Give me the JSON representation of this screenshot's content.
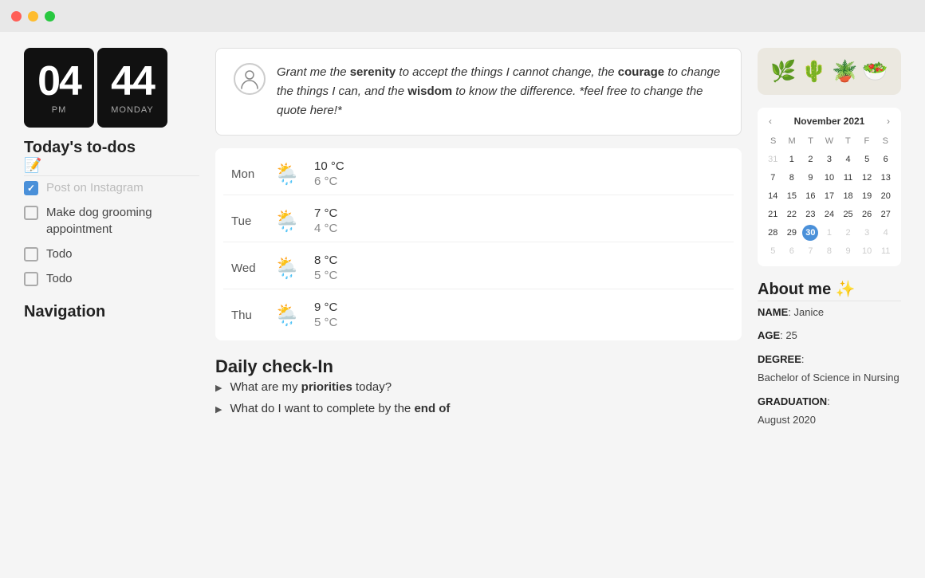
{
  "titlebar": {
    "dots": [
      "red",
      "yellow",
      "green"
    ]
  },
  "clock": {
    "hours": "04",
    "minutes": "44",
    "period": "PM",
    "day": "MONDAY"
  },
  "todos": {
    "section_title": "Today's to-dos",
    "edit_icon": "📝",
    "items": [
      {
        "id": 1,
        "checked": true,
        "text": "Post on Instagram"
      },
      {
        "id": 2,
        "checked": false,
        "text": "Make dog grooming appointment"
      },
      {
        "id": 3,
        "checked": false,
        "text": "Todo"
      },
      {
        "id": 4,
        "checked": false,
        "text": "Todo"
      }
    ]
  },
  "navigation": {
    "title": "Navigation"
  },
  "quote": {
    "text_before_bold1": "Grant me the ",
    "bold1": "serenity",
    "text_after_bold1": " to accept the things I cannot change, the ",
    "bold2": "courage",
    "text_after_bold2": " to change the things I can, and the ",
    "bold3": "wisdom",
    "text_after_bold3": " to know the difference. *feel free to change the quote here!*"
  },
  "weather": {
    "days": [
      {
        "day": "Mon",
        "icon": "🌧️",
        "high": "10 °C",
        "low": "6 °C"
      },
      {
        "day": "Tue",
        "icon": "🌧️",
        "high": "7 °C",
        "low": "4 °C"
      },
      {
        "day": "Wed",
        "icon": "🌧️",
        "high": "8 °C",
        "low": "5 °C"
      },
      {
        "day": "Thu",
        "icon": "🌧️",
        "high": "9 °C",
        "low": "5 °C"
      }
    ]
  },
  "checkin": {
    "title": "Daily check-In",
    "items": [
      {
        "text_before": "What are my ",
        "bold": "priorities",
        "text_after": " today?"
      },
      {
        "text_before": "What do I want to complete by the ",
        "bold": "end of",
        "text_after": ""
      }
    ]
  },
  "plants": {
    "emojis": [
      "🌿",
      "🌵",
      "🪴",
      "🥗"
    ]
  },
  "calendar": {
    "month": "November 2021",
    "day_headers": [
      "S",
      "M",
      "T",
      "W",
      "T",
      "F",
      "S"
    ],
    "rows": [
      [
        {
          "num": "31",
          "muted": true
        },
        {
          "num": "1"
        },
        {
          "num": "2"
        },
        {
          "num": "3"
        },
        {
          "num": "4"
        },
        {
          "num": "5"
        },
        {
          "num": "6"
        }
      ],
      [
        {
          "num": "7"
        },
        {
          "num": "8"
        },
        {
          "num": "9"
        },
        {
          "num": "10"
        },
        {
          "num": "11"
        },
        {
          "num": "12"
        },
        {
          "num": "13"
        }
      ],
      [
        {
          "num": "14"
        },
        {
          "num": "15"
        },
        {
          "num": "16"
        },
        {
          "num": "17"
        },
        {
          "num": "18"
        },
        {
          "num": "19"
        },
        {
          "num": "20"
        }
      ],
      [
        {
          "num": "21"
        },
        {
          "num": "22"
        },
        {
          "num": "23"
        },
        {
          "num": "24"
        },
        {
          "num": "25"
        },
        {
          "num": "26"
        },
        {
          "num": "27"
        }
      ],
      [
        {
          "num": "28"
        },
        {
          "num": "29"
        },
        {
          "num": "30",
          "today": true
        },
        {
          "num": "1",
          "muted": true
        },
        {
          "num": "2",
          "muted": true
        },
        {
          "num": "3",
          "muted": true
        },
        {
          "num": "4",
          "muted": true
        }
      ],
      [
        {
          "num": "5",
          "muted": true
        },
        {
          "num": "6",
          "muted": true
        },
        {
          "num": "7",
          "muted": true
        },
        {
          "num": "8",
          "muted": true
        },
        {
          "num": "9",
          "muted": true
        },
        {
          "num": "10",
          "muted": true
        },
        {
          "num": "11",
          "muted": true
        }
      ]
    ]
  },
  "about": {
    "title": "About me",
    "sparkle": "✨",
    "fields": [
      {
        "label": "NAME",
        "value": "Janice"
      },
      {
        "label": "AGE",
        "value": "25"
      },
      {
        "label": "DEGREE",
        "value": "Bachelor of Science in Nursing"
      },
      {
        "label": "GRADUATION",
        "value": "August 2020"
      }
    ]
  }
}
